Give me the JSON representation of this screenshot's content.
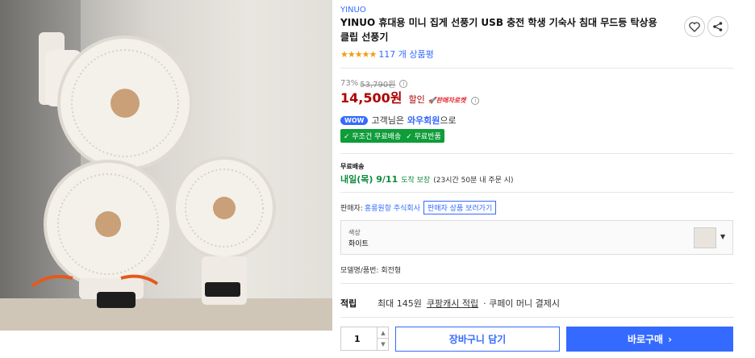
{
  "product": {
    "brand": "YINUO",
    "title": "YINUO 휴대용 미니 집게 선풍기 USB 충전 학생 기숙사 침대 무드등 탁상용 클립 선풍기",
    "rating_stars": "★★★★★",
    "review_count": "117 개 상품평"
  },
  "price": {
    "discount_rate": "73%",
    "original_price": "53,790원",
    "sale_price": "14,500원",
    "discount_label": "할인",
    "seller_rocket": "🚀판매자로켓",
    "info_glyph": "i"
  },
  "wow": {
    "badge": "WOW",
    "text_prefix": "고객님은",
    "highlight": "와우회원",
    "text_suffix": "으로"
  },
  "shipping_badges": [
    "✓ 무조건 무료배송",
    "✓ 무료반품"
  ],
  "delivery": {
    "title": "무료배송",
    "date": "내일(목) 9/11",
    "guarantee": "도착 보장",
    "cutoff": "(23시간 50분 내 주문 시)"
  },
  "seller": {
    "label": "판매자:",
    "name": "홍릉원항 주식회사",
    "link": "판매자 상품 보러가기"
  },
  "option": {
    "label": "색상",
    "value": "화이트"
  },
  "model": "모델명/품번: 회전형",
  "cash": {
    "head": "적립",
    "amount": "최대 145원",
    "link": "쿠팡캐시 적립",
    "suffix": "· 쿠페이 머니 결제시"
  },
  "purchase": {
    "quantity": "1",
    "cart_label": "장바구니 담기",
    "buy_label": "바로구매",
    "buy_arrow": "›"
  },
  "icons": [
    "heart-icon",
    "share-icon",
    "chevron-down-icon",
    "chevron-up-icon",
    "info-icon",
    "check-icon"
  ],
  "colors": {
    "accent": "#346aff",
    "price_red": "#ae0000",
    "delivery_green": "#0f8a3d",
    "badge_green": "#0f9d3a"
  }
}
